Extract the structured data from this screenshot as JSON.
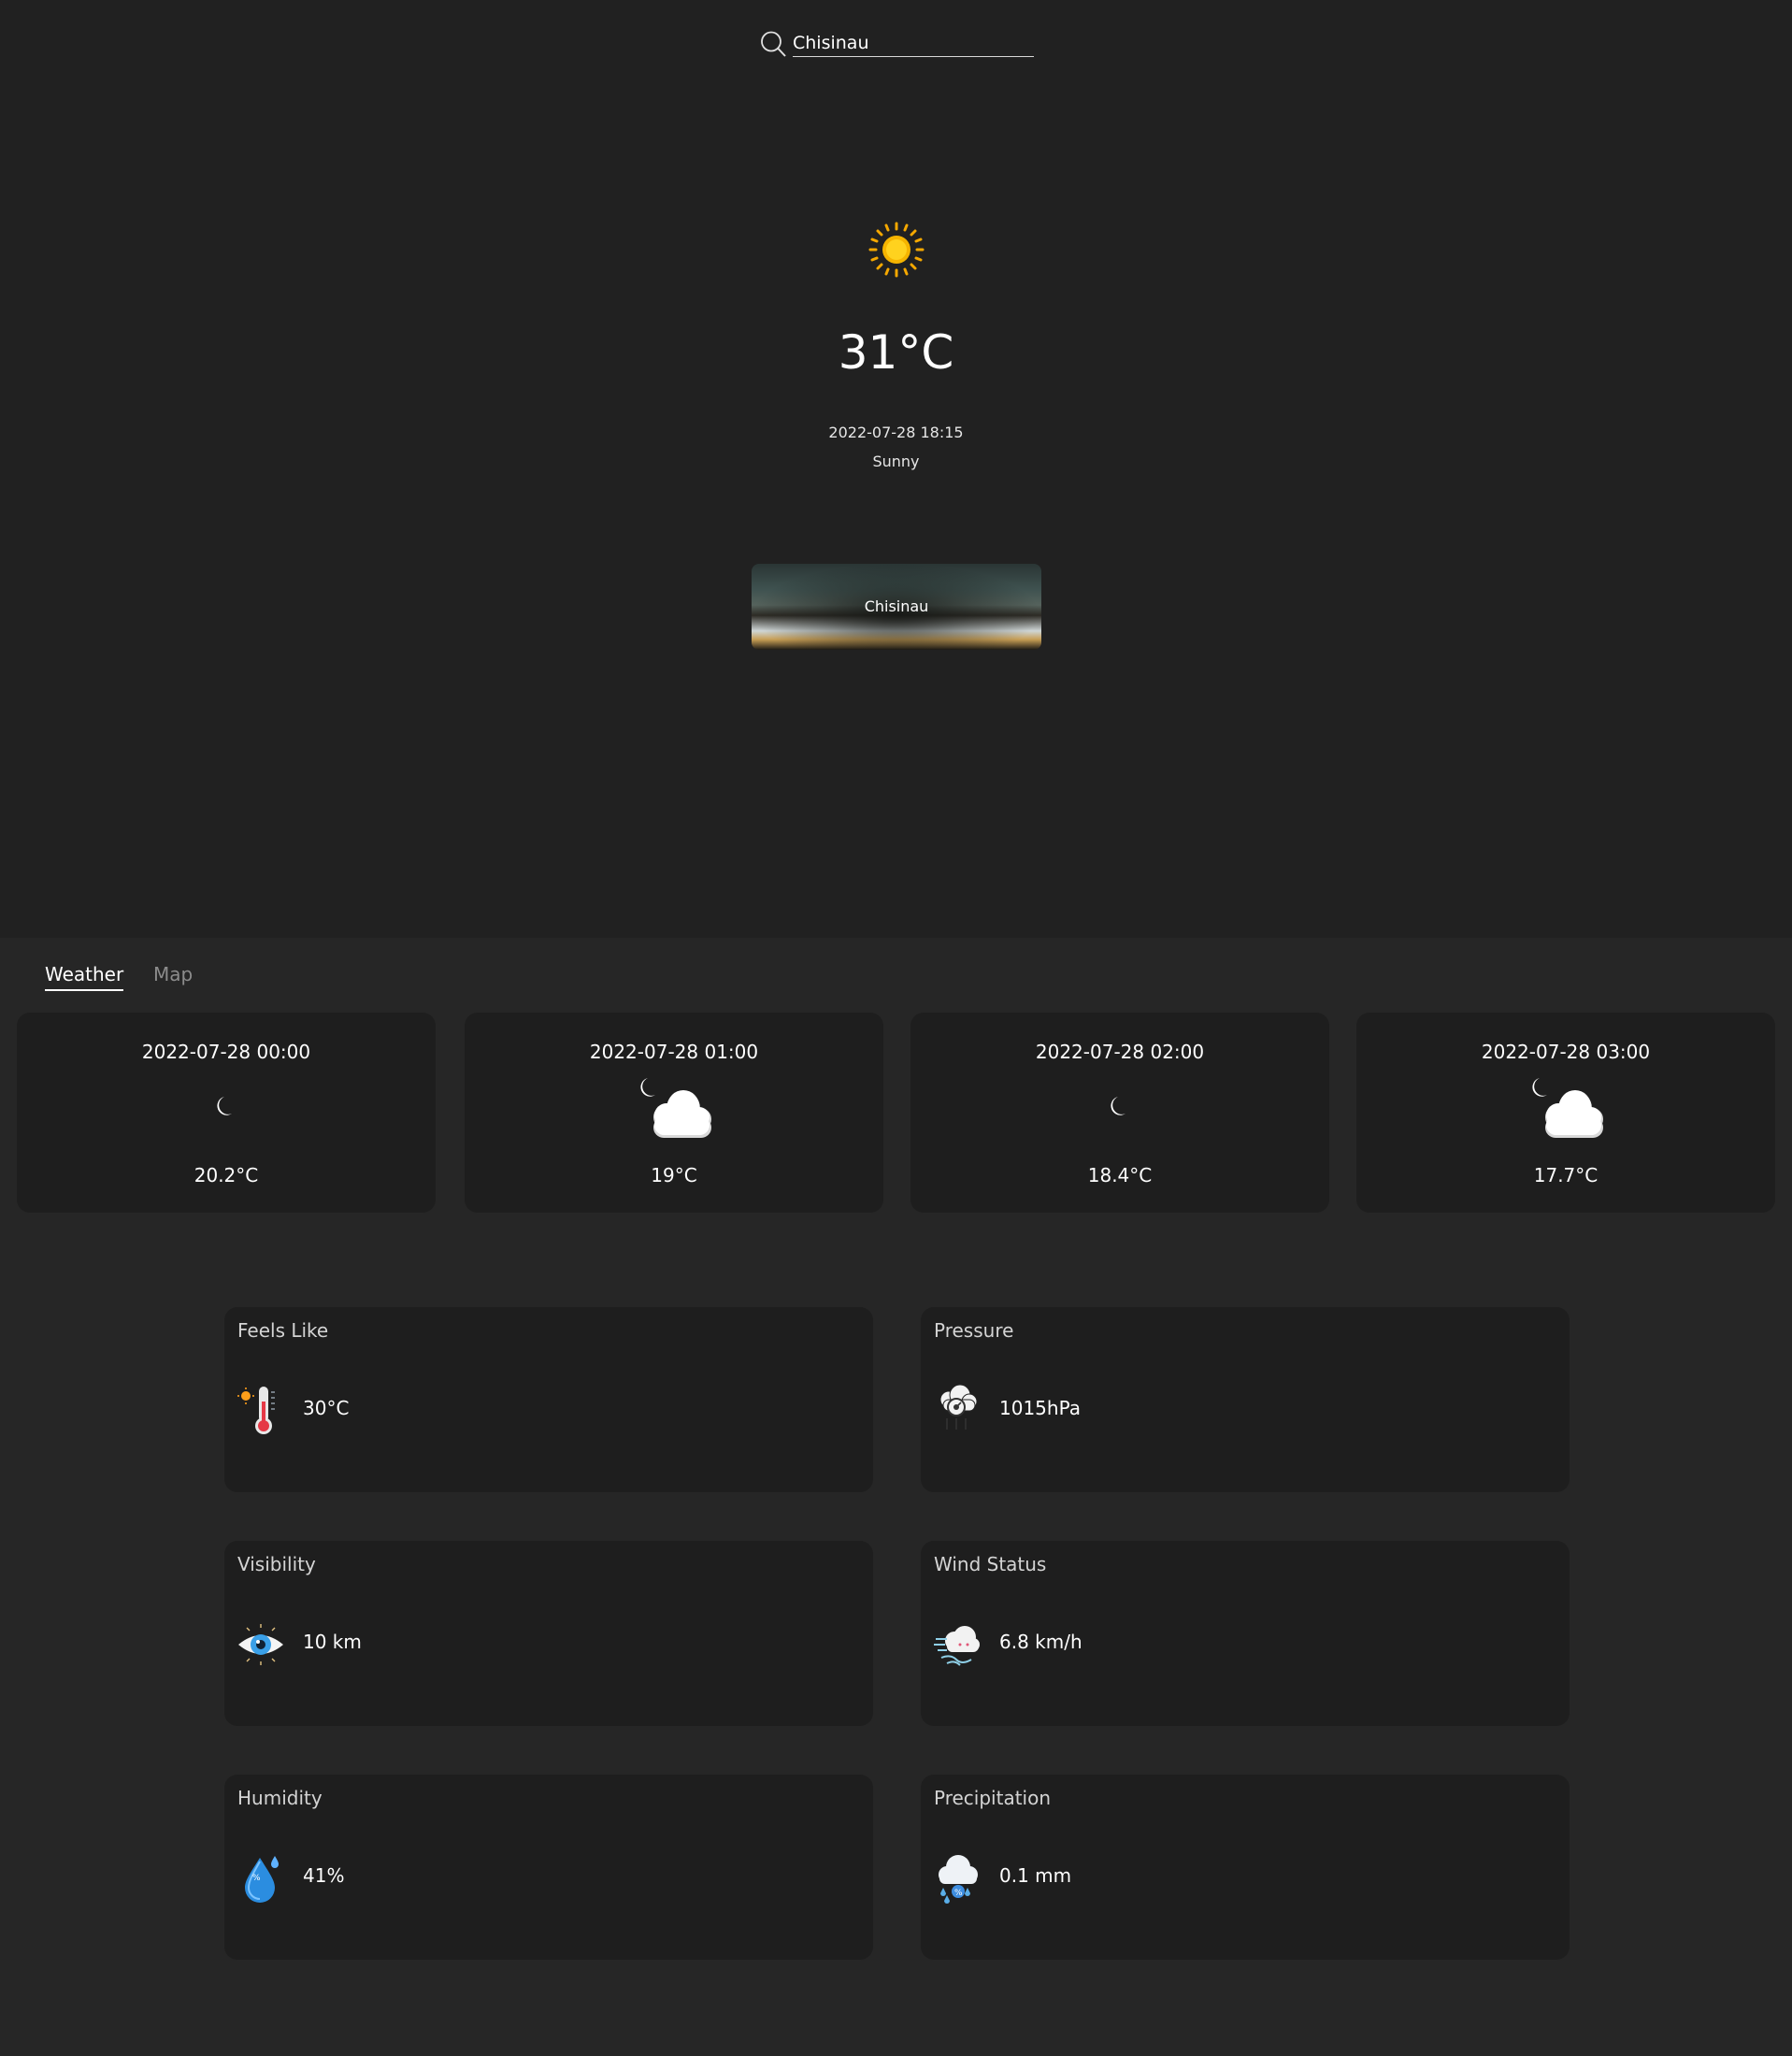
{
  "search": {
    "value": "Chisinau",
    "icon": "search-icon"
  },
  "current": {
    "icon": "sun-icon",
    "temperature": "31°C",
    "datetime": "2022-07-28 18:15",
    "condition": "Sunny",
    "city_card_label": "Chisinau"
  },
  "tabs": [
    {
      "label": "Weather",
      "active": true
    },
    {
      "label": "Map",
      "active": false
    }
  ],
  "forecast": [
    {
      "time": "2022-07-28 00:00",
      "icon": "moon-icon",
      "temp": "20.2°C"
    },
    {
      "time": "2022-07-28 01:00",
      "icon": "moon-cloud-icon",
      "temp": "19°C"
    },
    {
      "time": "2022-07-28 02:00",
      "icon": "moon-icon",
      "temp": "18.4°C"
    },
    {
      "time": "2022-07-28 03:00",
      "icon": "moon-cloud-icon",
      "temp": "17.7°C"
    }
  ],
  "metrics": {
    "feels_like": {
      "title": "Feels Like",
      "value": "30°C",
      "icon": "thermometer-icon"
    },
    "pressure": {
      "title": "Pressure",
      "value": "1015hPa",
      "icon": "barometer-icon"
    },
    "visibility": {
      "title": "Visibility",
      "value": "10 km",
      "icon": "eye-icon"
    },
    "wind": {
      "title": "Wind Status",
      "value": "6.8 km/h",
      "icon": "wind-icon"
    },
    "humidity": {
      "title": "Humidity",
      "value": "41%",
      "icon": "humidity-drop-icon"
    },
    "precipitation": {
      "title": "Precipitation",
      "value": "0.1 mm",
      "icon": "rain-cloud-icon"
    }
  },
  "colors": {
    "background": "#212121",
    "panel": "#262626",
    "card": "#1e1e1e",
    "accent_blue": "#1e7fd6",
    "sun": "#f5b400"
  }
}
